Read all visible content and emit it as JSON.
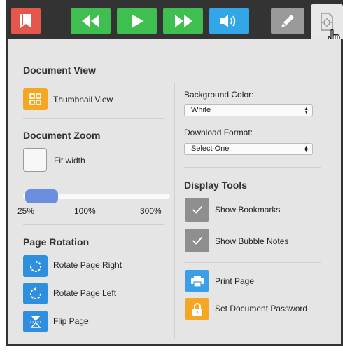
{
  "document_view": {
    "heading": "Document View",
    "thumbnail_label": "Thumbnail View"
  },
  "document_zoom": {
    "heading": "Document Zoom",
    "fit_width_label": "Fit width",
    "fit_width_checked": false,
    "slider_min_label": "25%",
    "slider_mid_label": "100%",
    "slider_max_label": "300%"
  },
  "page_rotation": {
    "heading": "Page Rotation",
    "rotate_right_label": "Rotate Page Right",
    "rotate_left_label": "Rotate Page Left",
    "flip_label": "Flip Page"
  },
  "background": {
    "label": "Background Color:",
    "value": "White"
  },
  "download": {
    "label": "Download Format:",
    "value": "Select One"
  },
  "display_tools": {
    "heading": "Display Tools",
    "bookmarks_label": "Show Bookmarks",
    "bookmarks_checked": true,
    "bubble_notes_label": "Show Bubble Notes",
    "bubble_notes_checked": true
  },
  "actions": {
    "print_label": "Print Page",
    "password_label": "Set Document Password"
  },
  "toolbar": {
    "icons": [
      "bookmark-icon",
      "rewind-icon",
      "play-icon",
      "fast-forward-icon",
      "volume-icon",
      "pen-icon",
      "document-settings-icon"
    ]
  },
  "colors": {
    "toolbar_bg": "#333333",
    "bookmark_red": "#e5574d",
    "media_green": "#3fbf4f",
    "volume_blue": "#32a6e6",
    "orange": "#f5a623",
    "action_blue": "#2f8fdf",
    "checked_gray": "#8f8f8f",
    "slider_blue": "#6b8fde"
  }
}
